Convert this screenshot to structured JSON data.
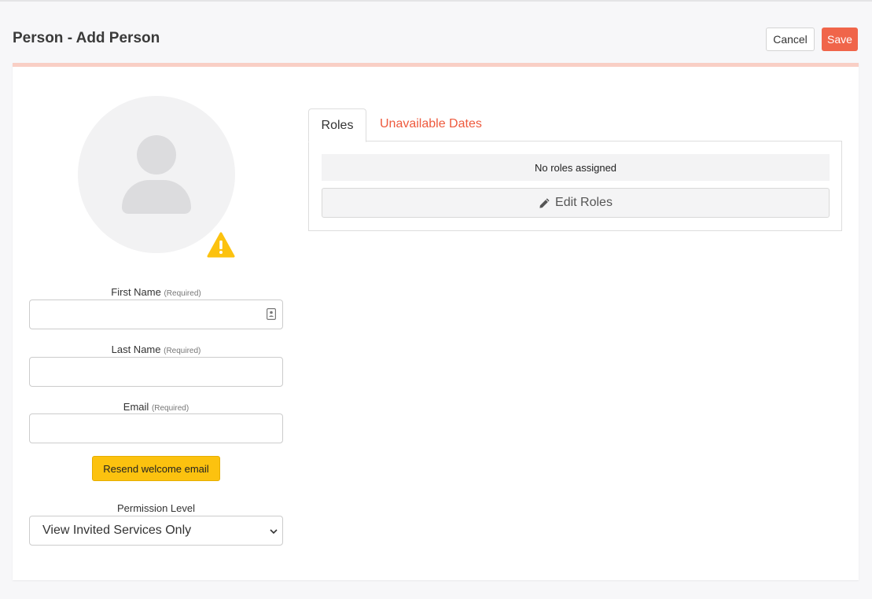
{
  "header": {
    "title": "Person - Add Person",
    "cancel_label": "Cancel",
    "save_label": "Save"
  },
  "form": {
    "required_tag": "(Required)",
    "first_name": {
      "label": "First Name",
      "value": ""
    },
    "last_name": {
      "label": "Last Name",
      "value": ""
    },
    "email": {
      "label": "Email",
      "value": ""
    },
    "resend_label": "Resend welcome email",
    "permission": {
      "label": "Permission Level",
      "selected": "View Invited Services Only"
    }
  },
  "tabs": {
    "roles_label": "Roles",
    "dates_label": "Unavailable Dates",
    "active": "Roles"
  },
  "roles_panel": {
    "empty_text": "No roles assigned",
    "edit_label": "Edit Roles"
  },
  "icons": {
    "avatar": "user-placeholder-icon",
    "warning": "warning-icon",
    "contact": "contact-card-icon",
    "chevron": "chevron-down-icon",
    "edit": "pencil-icon"
  },
  "colors": {
    "accent": "#f0654a",
    "tab_link": "#ee5a3d",
    "warning": "#fcc20f",
    "card_top_border": "#f9cfc5"
  }
}
